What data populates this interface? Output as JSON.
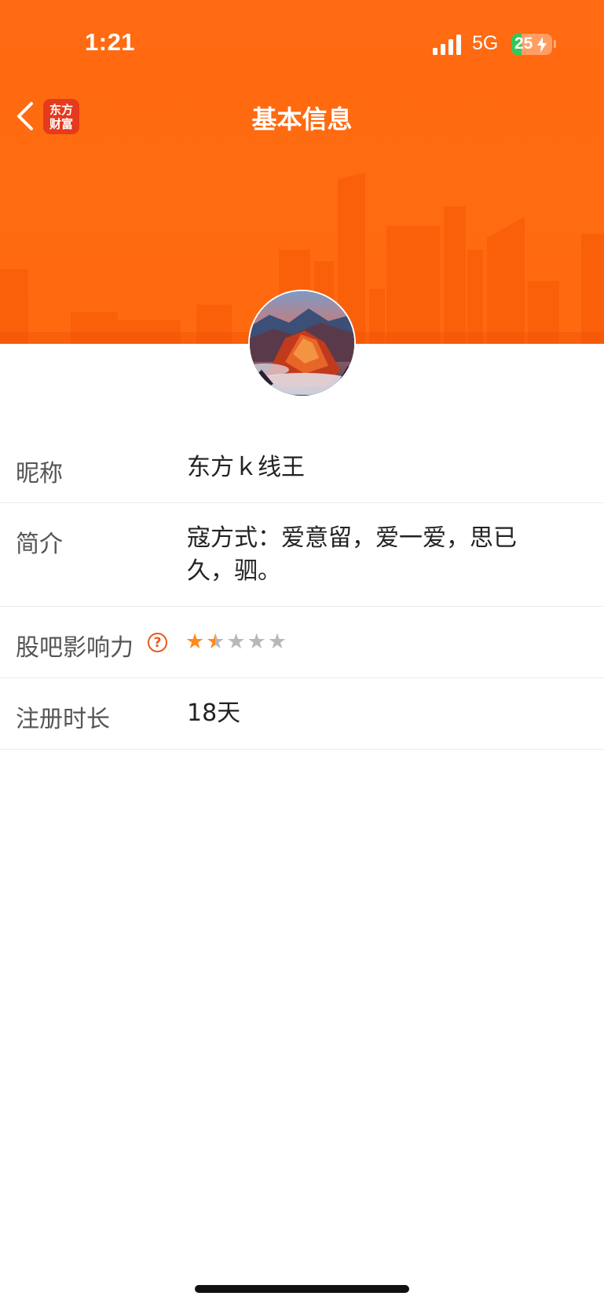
{
  "status_bar": {
    "time": "1:21",
    "network": "5G",
    "battery": "25",
    "battery_level": 0.25
  },
  "nav": {
    "title": "基本信息",
    "logo_line1": "东方",
    "logo_line2": "财富"
  },
  "profile": {
    "nickname_label": "昵称",
    "nickname": "东方ｋ线王",
    "bio_label": "简介",
    "bio": " 寇方式：爱意留，爱一爱，思已久，驷。",
    "influence_label": "股吧影响力",
    "influence_help": "?",
    "influence_rating": 1.5,
    "influence_max": 5,
    "register_label": "注册时长",
    "register_duration": "18天"
  },
  "colors": {
    "brand_orange": "#ff6a12",
    "star_active": "#ff8a1e",
    "star_inactive": "#b8b8b8"
  }
}
